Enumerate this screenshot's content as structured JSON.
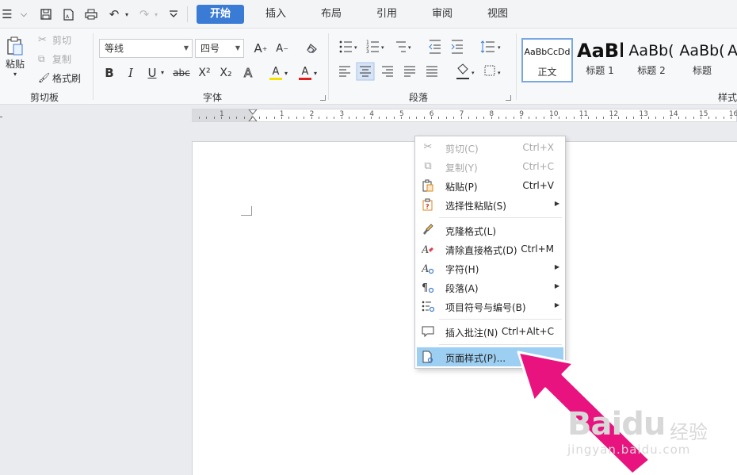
{
  "tabs": {
    "items": [
      "开始",
      "插入",
      "布局",
      "引用",
      "审阅",
      "视图"
    ],
    "active": "开始"
  },
  "quick_access": {
    "icons": [
      "menu-icon",
      "chevron-down-icon",
      "save-icon",
      "pdf-icon",
      "print-icon",
      "undo-icon",
      "redo-icon",
      "customize-icon"
    ]
  },
  "clipboard": {
    "paste": "粘贴",
    "cut": "剪切",
    "copy": "复制",
    "format_painter": "格式刷",
    "group_label": "剪切板"
  },
  "font": {
    "family": "等线",
    "size": "四号",
    "grow_label": "A",
    "shrink_label": "A",
    "bold": "B",
    "italic": "I",
    "underline": "U",
    "strike": "abc",
    "superscript": "X²",
    "subscript": "X₂",
    "text_effect": "A",
    "highlight": "A",
    "font_color": "A",
    "group_label": "字体",
    "font_color_hex": "#e02020",
    "highlight_hex": "#f5e200"
  },
  "paragraph": {
    "group_label": "段落"
  },
  "styles": {
    "items": [
      {
        "preview": "AaBbCcDd",
        "name": "正文"
      },
      {
        "preview": "AaBl",
        "name": "标题 1"
      },
      {
        "preview": "AaBb(",
        "name": "标题 2"
      },
      {
        "preview": "AaBb(",
        "name": "标题"
      },
      {
        "preview": "A",
        "name": ""
      }
    ],
    "group_label": "样式"
  },
  "ruler": {
    "numbers": [
      "1",
      "1",
      "2",
      "3",
      "4",
      "5",
      "6",
      "7",
      "8",
      "9",
      "10",
      "11",
      "12",
      "13",
      "14",
      "15",
      "16"
    ]
  },
  "context_menu": {
    "items": [
      {
        "label": "剪切(C)",
        "shortcut": "Ctrl+X",
        "icon": "scissors-icon",
        "disabled": true
      },
      {
        "label": "复制(Y)",
        "shortcut": "Ctrl+C",
        "icon": "copy-icon",
        "disabled": true
      },
      {
        "label": "粘贴(P)",
        "shortcut": "Ctrl+V",
        "icon": "paste-icon"
      },
      {
        "label": "选择性粘贴(S)",
        "shortcut": "",
        "icon": "paste-special-icon",
        "submenu": true
      },
      {
        "label": "克隆格式(L)",
        "shortcut": "",
        "icon": "brush-icon"
      },
      {
        "label": "清除直接格式(D)",
        "shortcut": "Ctrl+M",
        "icon": "clear-format-icon"
      },
      {
        "label": "字符(H)",
        "shortcut": "",
        "icon": "character-icon",
        "submenu": true
      },
      {
        "label": "段落(A)",
        "shortcut": "",
        "icon": "paragraph-icon",
        "submenu": true
      },
      {
        "label": "项目符号与编号(B)",
        "shortcut": "",
        "icon": "bullets-icon",
        "submenu": true
      },
      {
        "label": "插入批注(N)",
        "shortcut": "Ctrl+Alt+C",
        "icon": "comment-icon"
      },
      {
        "label": "页面样式(P)...",
        "shortcut": "",
        "icon": "page-style-icon",
        "highlighted": true
      }
    ],
    "highlight_hex": "#9dcff2"
  },
  "watermark": {
    "brand": "Baidu",
    "brand_cn": "经验",
    "url": "jingyan.baidu.com"
  },
  "colors": {
    "accent": "#3a7bd5",
    "pointer_arrow": "#e8137e"
  }
}
